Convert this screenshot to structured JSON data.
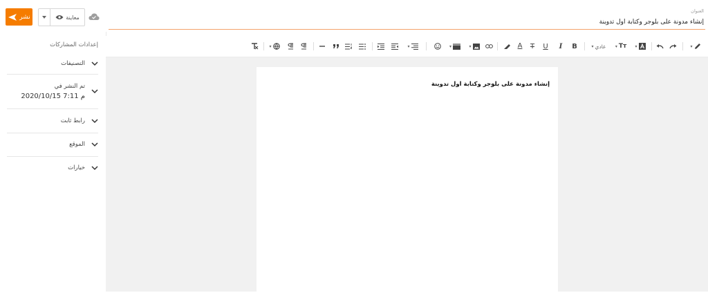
{
  "left_panel": {
    "publish_label": "نشر",
    "preview_label": "معاينة",
    "settings_title": "إعدادات المشاركات",
    "rows": {
      "categories": "التصنيفات",
      "published_title": "تم النشر في",
      "published_date": "2020/10/15 7:11 م",
      "permalink": "رابط ثابت",
      "location": "الموقع",
      "options": "خيارات"
    }
  },
  "title_area": {
    "label": "العنوان",
    "value": "إنشاء مدونة على بلوجر وكتابة اول تدوينة"
  },
  "toolbar": {
    "font_size_label": "عادي",
    "text_size_icon_label": "Tт",
    "bold_label": "B",
    "italic_label": "I",
    "underline_label": "U",
    "strike_label": "T",
    "text_color_label": "A"
  },
  "editor": {
    "heading": "إنشاء مدونة على بلوجر وكتابة اول تدوينة"
  },
  "colors": {
    "accent": "#f57c00",
    "title_underline": "#f5a36b",
    "canvas_bg": "#f1f1f1"
  }
}
